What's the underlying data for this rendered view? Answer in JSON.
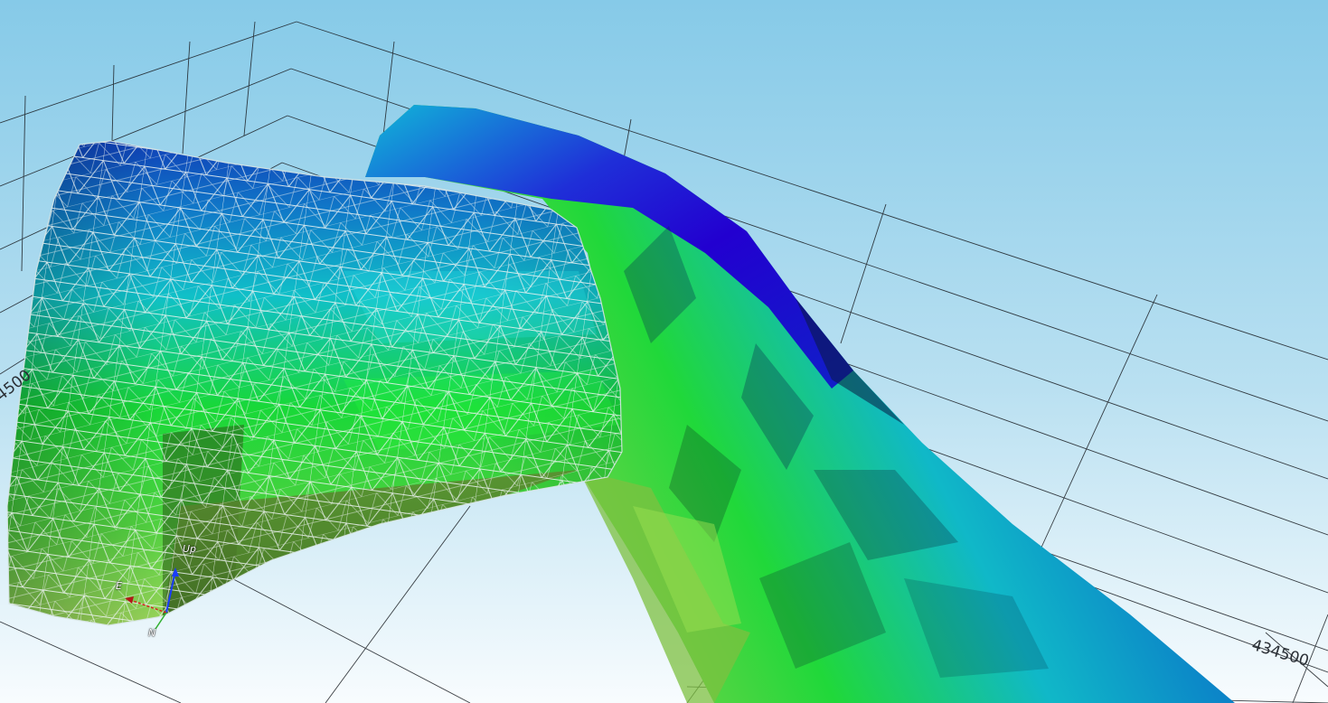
{
  "viewport": {
    "background_top": "#86cae8",
    "background_bottom": "#f7fbfd",
    "grid_color": "#1b1f24",
    "mesh_line_color": "#e8eef0",
    "surface_colors": [
      "#1a00c8",
      "#0a5fd0",
      "#10c8d8",
      "#16e036",
      "#8ed84a"
    ]
  },
  "axes": {
    "tick_label_right": "434500",
    "tick_label_left": "4500"
  },
  "orientation_triad": {
    "up_label": "Up",
    "east_label": "E",
    "north_label": "N",
    "up_color": "#1a3cff",
    "east_color": "#d82020",
    "north_color": "#30b030"
  }
}
